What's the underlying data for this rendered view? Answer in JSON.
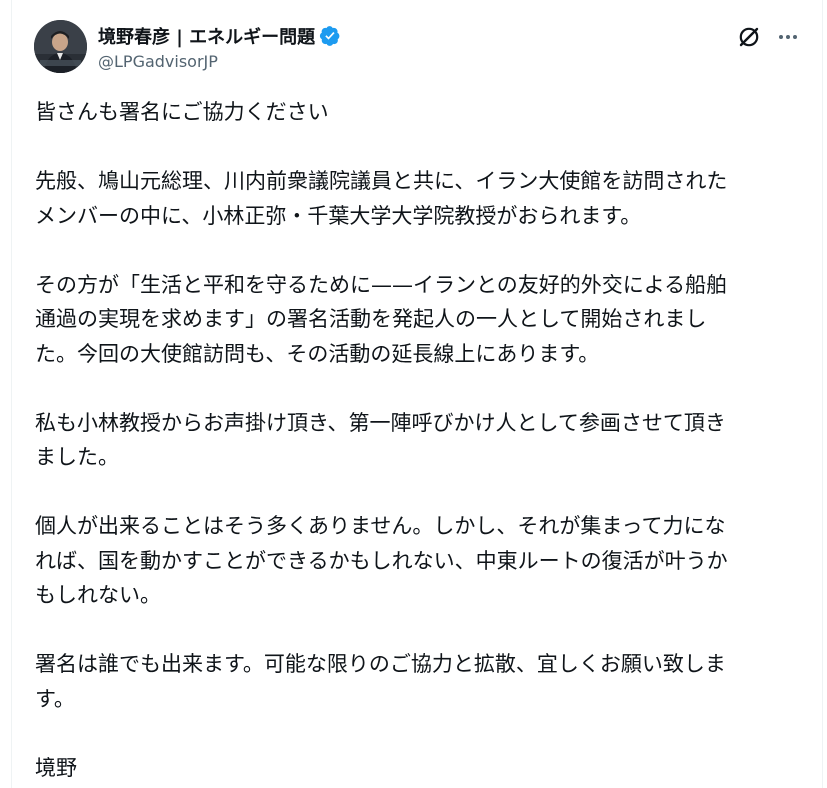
{
  "post": {
    "author": {
      "display_name": "境野春彦 | エネルギー問題",
      "handle": "@LPGadvisorJP",
      "verified": true,
      "verified_color": "#1d9bf0"
    },
    "actions": {
      "grok_icon": "grok-icon",
      "more_icon": "more-icon"
    },
    "paragraphs": [
      "皆さんも署名にご協力ください",
      "先般、鳩山元総理、川内前衆議院議員と共に、イラン大使館を訪問された\nメンバーの中に、小林正弥・千葉大学大学院教授がおられます。",
      "その方が「生活と平和を守るために——イランとの友好的外交による船舶\n通過の実現を求めます」の署名活動を発起人の一人として開始されまし\nた。今回の大使館訪問も、その活動の延長線上にあります。",
      "私も小林教授からお声掛け頂き、第一陣呼びかけ人として参画させて頂き\nました。",
      "個人が出来ることはそう多くありません。しかし、それが集まって力にな\nれば、国を動かすことができるかもしれない、中東ルートの復活が叶うか\nもしれない。",
      "署名は誰でも出来ます。可能な限りのご協力と拡散、宜しくお願い致しま\nす。",
      "境野"
    ]
  }
}
